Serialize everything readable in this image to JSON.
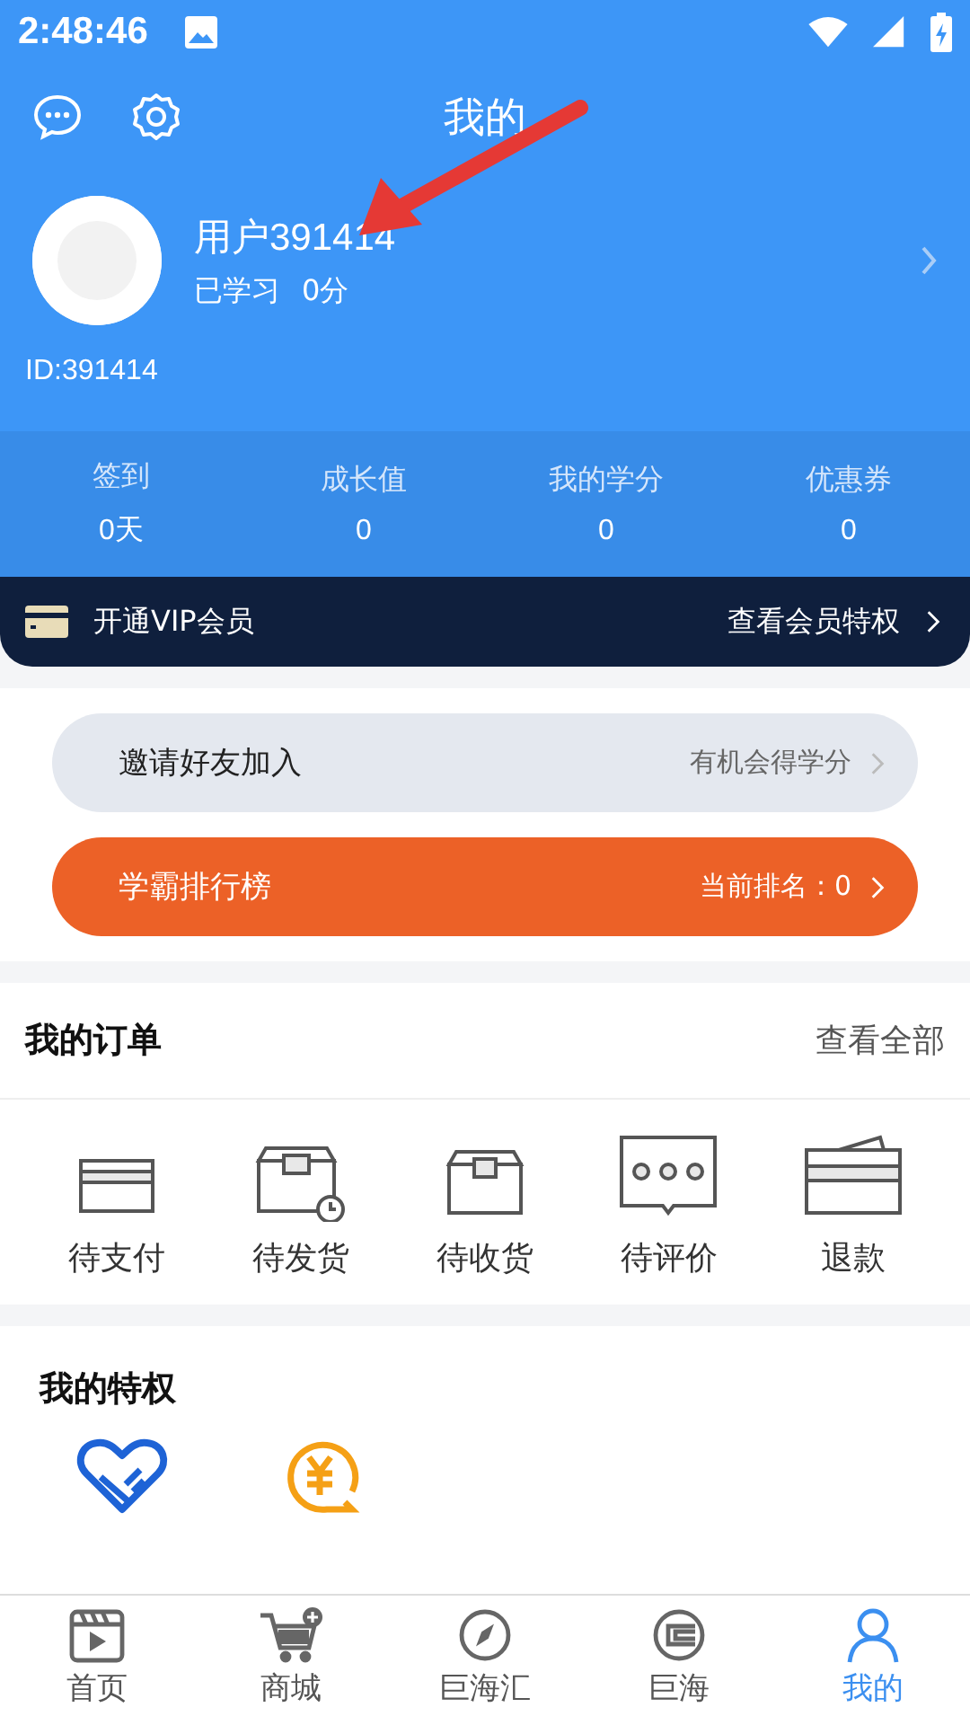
{
  "status_bar": {
    "time": "2:48:46"
  },
  "header": {
    "title": "我的"
  },
  "profile": {
    "name": "用户391414",
    "studied_label": "已学习",
    "studied_value": "0分",
    "id": "ID:391414"
  },
  "stats": [
    {
      "label": "签到",
      "value": "0天"
    },
    {
      "label": "成长值",
      "value": "0"
    },
    {
      "label": "我的学分",
      "value": "0"
    },
    {
      "label": "优惠券",
      "value": "0"
    }
  ],
  "vip": {
    "label": "开通VIP会员",
    "link": "查看会员特权"
  },
  "invite": {
    "label": "有机会得学分",
    "title": "邀请好友加入"
  },
  "ranking": {
    "title": "学霸排行榜",
    "label": "当前排名：0"
  },
  "orders": {
    "title": "我的订单",
    "link": "查看全部",
    "items": [
      {
        "kind": "pay",
        "label": "待支付"
      },
      {
        "kind": "ship",
        "label": "待发货"
      },
      {
        "kind": "receive",
        "label": "待收货"
      },
      {
        "kind": "review",
        "label": "待评价"
      },
      {
        "kind": "refund",
        "label": "退款"
      }
    ]
  },
  "privileges": {
    "title": "我的特权",
    "items": [
      {
        "kind": "heart"
      },
      {
        "kind": "coin"
      }
    ]
  },
  "nav": [
    {
      "kind": "video",
      "label": "首页",
      "selected": false
    },
    {
      "kind": "cart",
      "label": "商城",
      "selected": false
    },
    {
      "kind": "compass",
      "label": "巨海汇",
      "selected": false
    },
    {
      "kind": "logo",
      "label": "巨海",
      "selected": false
    },
    {
      "kind": "user",
      "label": "我的",
      "selected": true
    }
  ]
}
